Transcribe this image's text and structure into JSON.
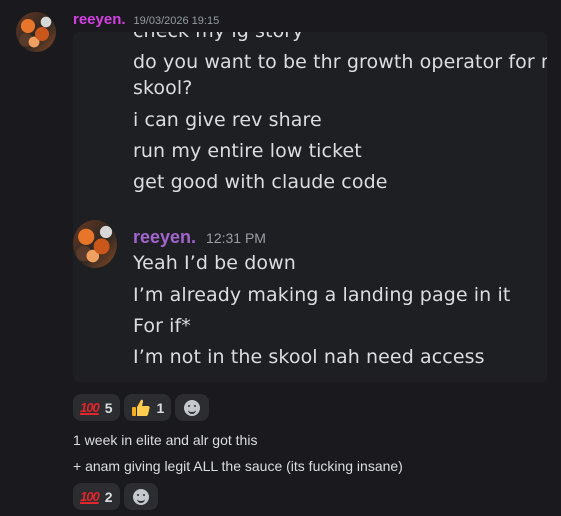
{
  "message": {
    "username": "reeyen.",
    "timestamp": "19/03/2026 19:15",
    "screenshot": {
      "lines": [
        "check my ig story",
        "do you want to be thr growth operator for my",
        "skool?",
        "i can give rev share",
        "run my entire low ticket",
        "get good with claude code"
      ],
      "reply": {
        "username": "reeyen.",
        "time": "12:31 PM",
        "lines": [
          "Yeah I’d be down",
          "I’m already making a landing page in it",
          "For if*",
          "I’m not in the skool nah need access"
        ]
      }
    },
    "reactions": [
      {
        "emoji": "100",
        "count": "5"
      },
      {
        "emoji": "thumbs-up",
        "count": "1"
      }
    ],
    "text_lines": [
      "1 week in elite and alr got this",
      "+ anam giving legit ALL the sauce (its fucking insane)"
    ],
    "reactions_2": [
      {
        "emoji": "100",
        "count": "2"
      }
    ]
  }
}
